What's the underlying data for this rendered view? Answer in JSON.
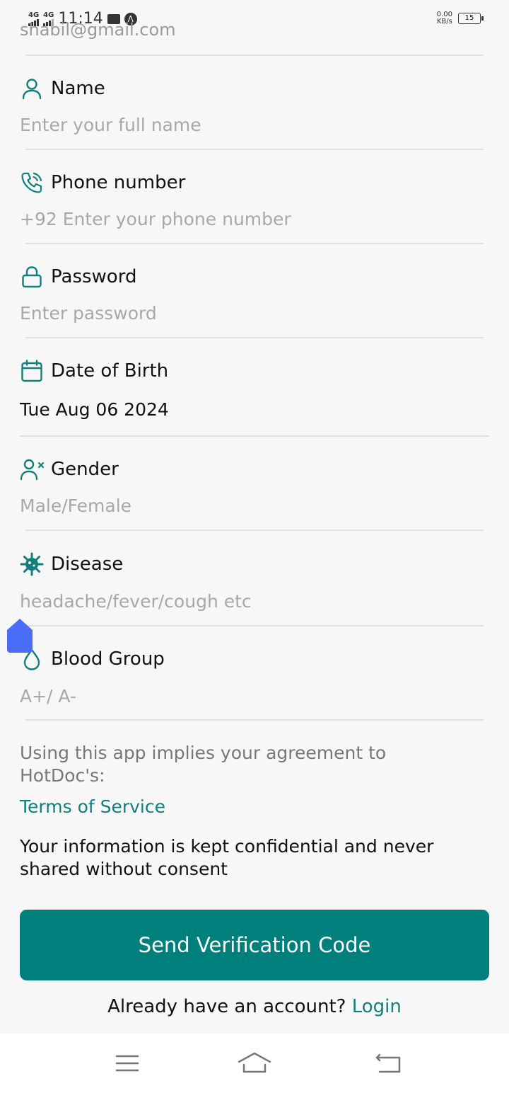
{
  "status_bar": {
    "network1": "4G",
    "network2": "4G",
    "time": "11:14",
    "speed_value": "0.00",
    "speed_unit": "KB/s",
    "battery": "15"
  },
  "email": {
    "value": "shabil@gmail.com"
  },
  "fields": {
    "name": {
      "label": "Name",
      "placeholder": "Enter your full name"
    },
    "phone": {
      "label": "Phone number",
      "placeholder": "+92 Enter your phone number"
    },
    "password": {
      "label": "Password",
      "placeholder": "Enter password"
    },
    "dob": {
      "label": "Date of Birth",
      "value": "Tue Aug 06 2024"
    },
    "gender": {
      "label": "Gender",
      "placeholder": "Male/Female"
    },
    "disease": {
      "label": "Disease",
      "placeholder": "headache/fever/cough etc"
    },
    "blood": {
      "label": "Blood Group",
      "placeholder": "A+/ A-"
    }
  },
  "agreement": {
    "text": "Using this app implies your agreement to HotDoc's:",
    "terms_link": "Terms of Service",
    "confidential": "Your information is kept confidential and never shared without consent"
  },
  "submit": {
    "label": "Send Verification Code"
  },
  "login_prompt": {
    "text": "Already have an account? ",
    "link": "Login"
  },
  "colors": {
    "accent": "#00807c",
    "link": "#10807d"
  },
  "icons": [
    "user-icon",
    "phone-icon",
    "lock-icon",
    "calendar-icon",
    "gender-icon",
    "virus-icon",
    "blood-drop-icon",
    "menu-icon",
    "home-icon",
    "back-icon"
  ]
}
